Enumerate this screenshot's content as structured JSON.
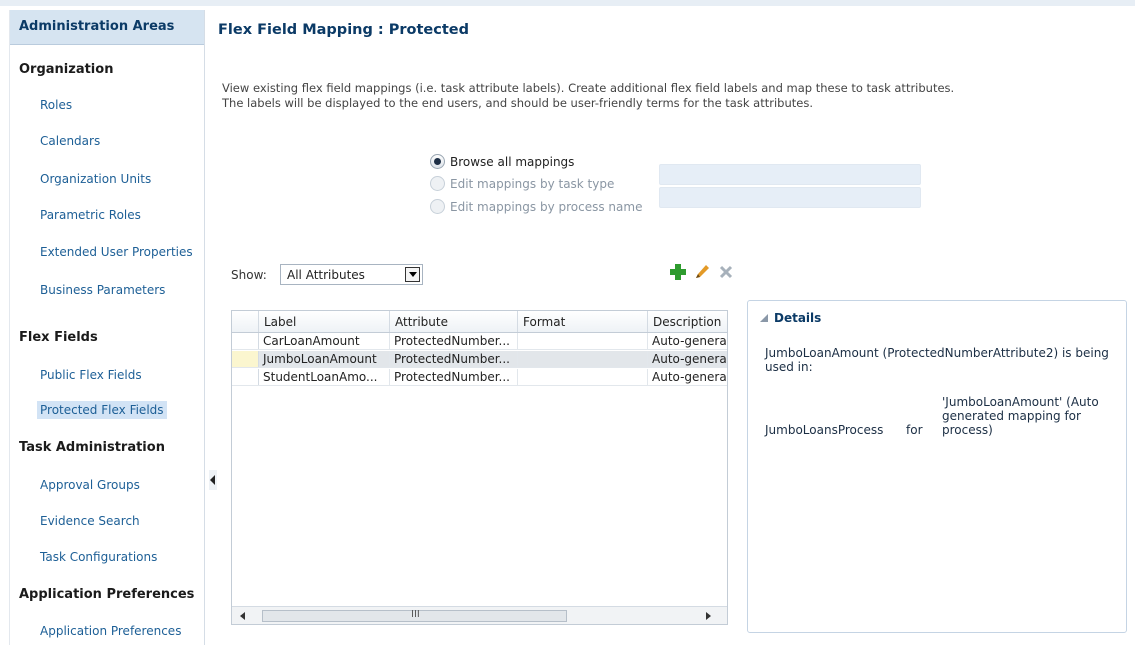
{
  "sidebar": {
    "title": "Administration Areas",
    "sections": [
      {
        "label": "Organization"
      },
      {
        "label": "Flex Fields"
      },
      {
        "label": "Task Administration"
      },
      {
        "label": "Application Preferences"
      }
    ],
    "items": [
      {
        "label": "Roles"
      },
      {
        "label": "Calendars"
      },
      {
        "label": "Organization Units"
      },
      {
        "label": "Parametric Roles"
      },
      {
        "label": "Extended User Properties"
      },
      {
        "label": "Business Parameters"
      },
      {
        "label": "Public Flex Fields"
      },
      {
        "label": "Protected Flex Fields"
      },
      {
        "label": "Approval Groups"
      },
      {
        "label": "Evidence Search"
      },
      {
        "label": "Task Configurations"
      },
      {
        "label": "Application Preferences"
      }
    ]
  },
  "page": {
    "title": "Flex Field Mapping : Protected",
    "description_line1": "View existing flex field mappings (i.e. task attribute labels). Create additional flex field labels and map these to task attributes.",
    "description_line2": "The labels will be displayed to the end users, and should be user-friendly terms for the task attributes."
  },
  "mapping_options": [
    {
      "label": "Browse all mappings",
      "checked": true,
      "disabled": false
    },
    {
      "label": "Edit mappings by task type",
      "checked": false,
      "disabled": true
    },
    {
      "label": "Edit mappings by process name",
      "checked": false,
      "disabled": true
    }
  ],
  "filter": {
    "show_label": "Show:",
    "selected": "All Attributes"
  },
  "toolbar": {
    "add_icon": "plus-icon",
    "edit_icon": "pencil-icon",
    "delete_icon": "x-icon",
    "add_color": "#2e9b2e",
    "edit_color": "#d98a1c"
  },
  "table": {
    "columns": [
      "Label",
      "Attribute",
      "Format",
      "Description"
    ],
    "rows": [
      {
        "label": "CarLoanAmount",
        "attribute": "ProtectedNumber...",
        "format": "",
        "description": "Auto-genera"
      },
      {
        "label": "JumboLoanAmount",
        "attribute": "ProtectedNumber...",
        "format": "",
        "description": "Auto-genera"
      },
      {
        "label": "StudentLoanAmo...",
        "attribute": "ProtectedNumber...",
        "format": "",
        "description": "Auto-genera"
      }
    ],
    "scroll_grip": "III"
  },
  "details": {
    "title": "Details",
    "usage_text": "JumboLoanAmount (ProtectedNumberAttribute2) is being used in:",
    "process": "JumboLoansProcess",
    "for_word": "for",
    "usage_description": "'JumboLoanAmount' (Auto generated mapping for process)"
  }
}
